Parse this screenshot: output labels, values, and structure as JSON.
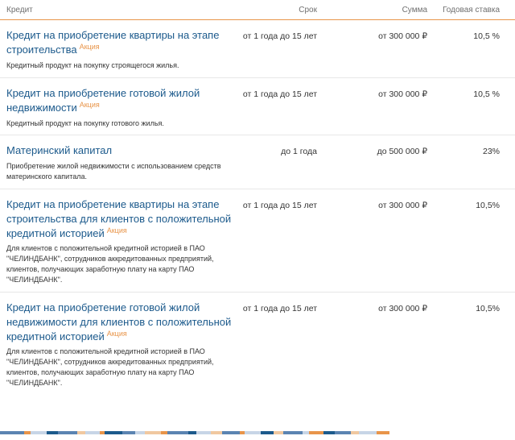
{
  "header": {
    "credit": "Кредит",
    "term": "Срок",
    "sum": "Сумма",
    "rate": "Годовая ставка"
  },
  "rows": [
    {
      "title": "Кредит на приобретение квартиры на этапе строительства",
      "promo": "Акция",
      "description": "Кредитный продукт на покупку строящегося жилья.",
      "term": "от 1 года до 15 лет",
      "sum": "от 300 000 ₽",
      "rate": "10,5 %"
    },
    {
      "title": "Кредит на приобретение готовой жилой недвижимости",
      "promo": "Акция",
      "description": "Кредитный продукт на покупку готового жилья.",
      "term": "от 1 года до 15 лет",
      "sum": "от 300 000 ₽",
      "rate": "10,5 %"
    },
    {
      "title": "Материнский капитал",
      "promo": "",
      "description": "Приобретение жилой недвижимости с использованием средств материнского капитала.",
      "term": "до 1 года",
      "sum": "до 500 000 ₽",
      "rate": "23%"
    },
    {
      "title": "Кредит на приобретение квартиры на этапе строительства для клиентов с положительной кредитной историей",
      "promo": "Акция",
      "description": "Для клиентов с положительной кредитной историей в ПАО \"ЧЕЛИНДБАНК\", сотрудников аккредитованных предприятий, клиентов, получающих заработную плату на карту ПАО \"ЧЕЛИНДБАНК\".",
      "term": "от 1 года до 15 лет",
      "sum": "от 300 000 ₽",
      "rate": "10,5%"
    },
    {
      "title": "Кредит на приобретение готовой жилой недвижимости для клиентов с положительной кредитной историей",
      "promo": "Акция",
      "description": "Для клиентов с положительной кредитной историей в ПАО \"ЧЕЛИНДБАНК\", сотрудников аккредитованных предприятий, клиентов, получающих заработную плату на карту ПАО \"ЧЕЛИНДБАНК\".",
      "term": "от 1 года до 15 лет",
      "sum": "от 300 000 ₽",
      "rate": "10,5%"
    }
  ],
  "colors": {
    "title": "#1c5a8c",
    "promo": "#e8954a",
    "stripe": [
      "#5b84b1",
      "#e8954a",
      "#c7d5e6",
      "#1c5a8c",
      "#f0c8a0"
    ]
  }
}
